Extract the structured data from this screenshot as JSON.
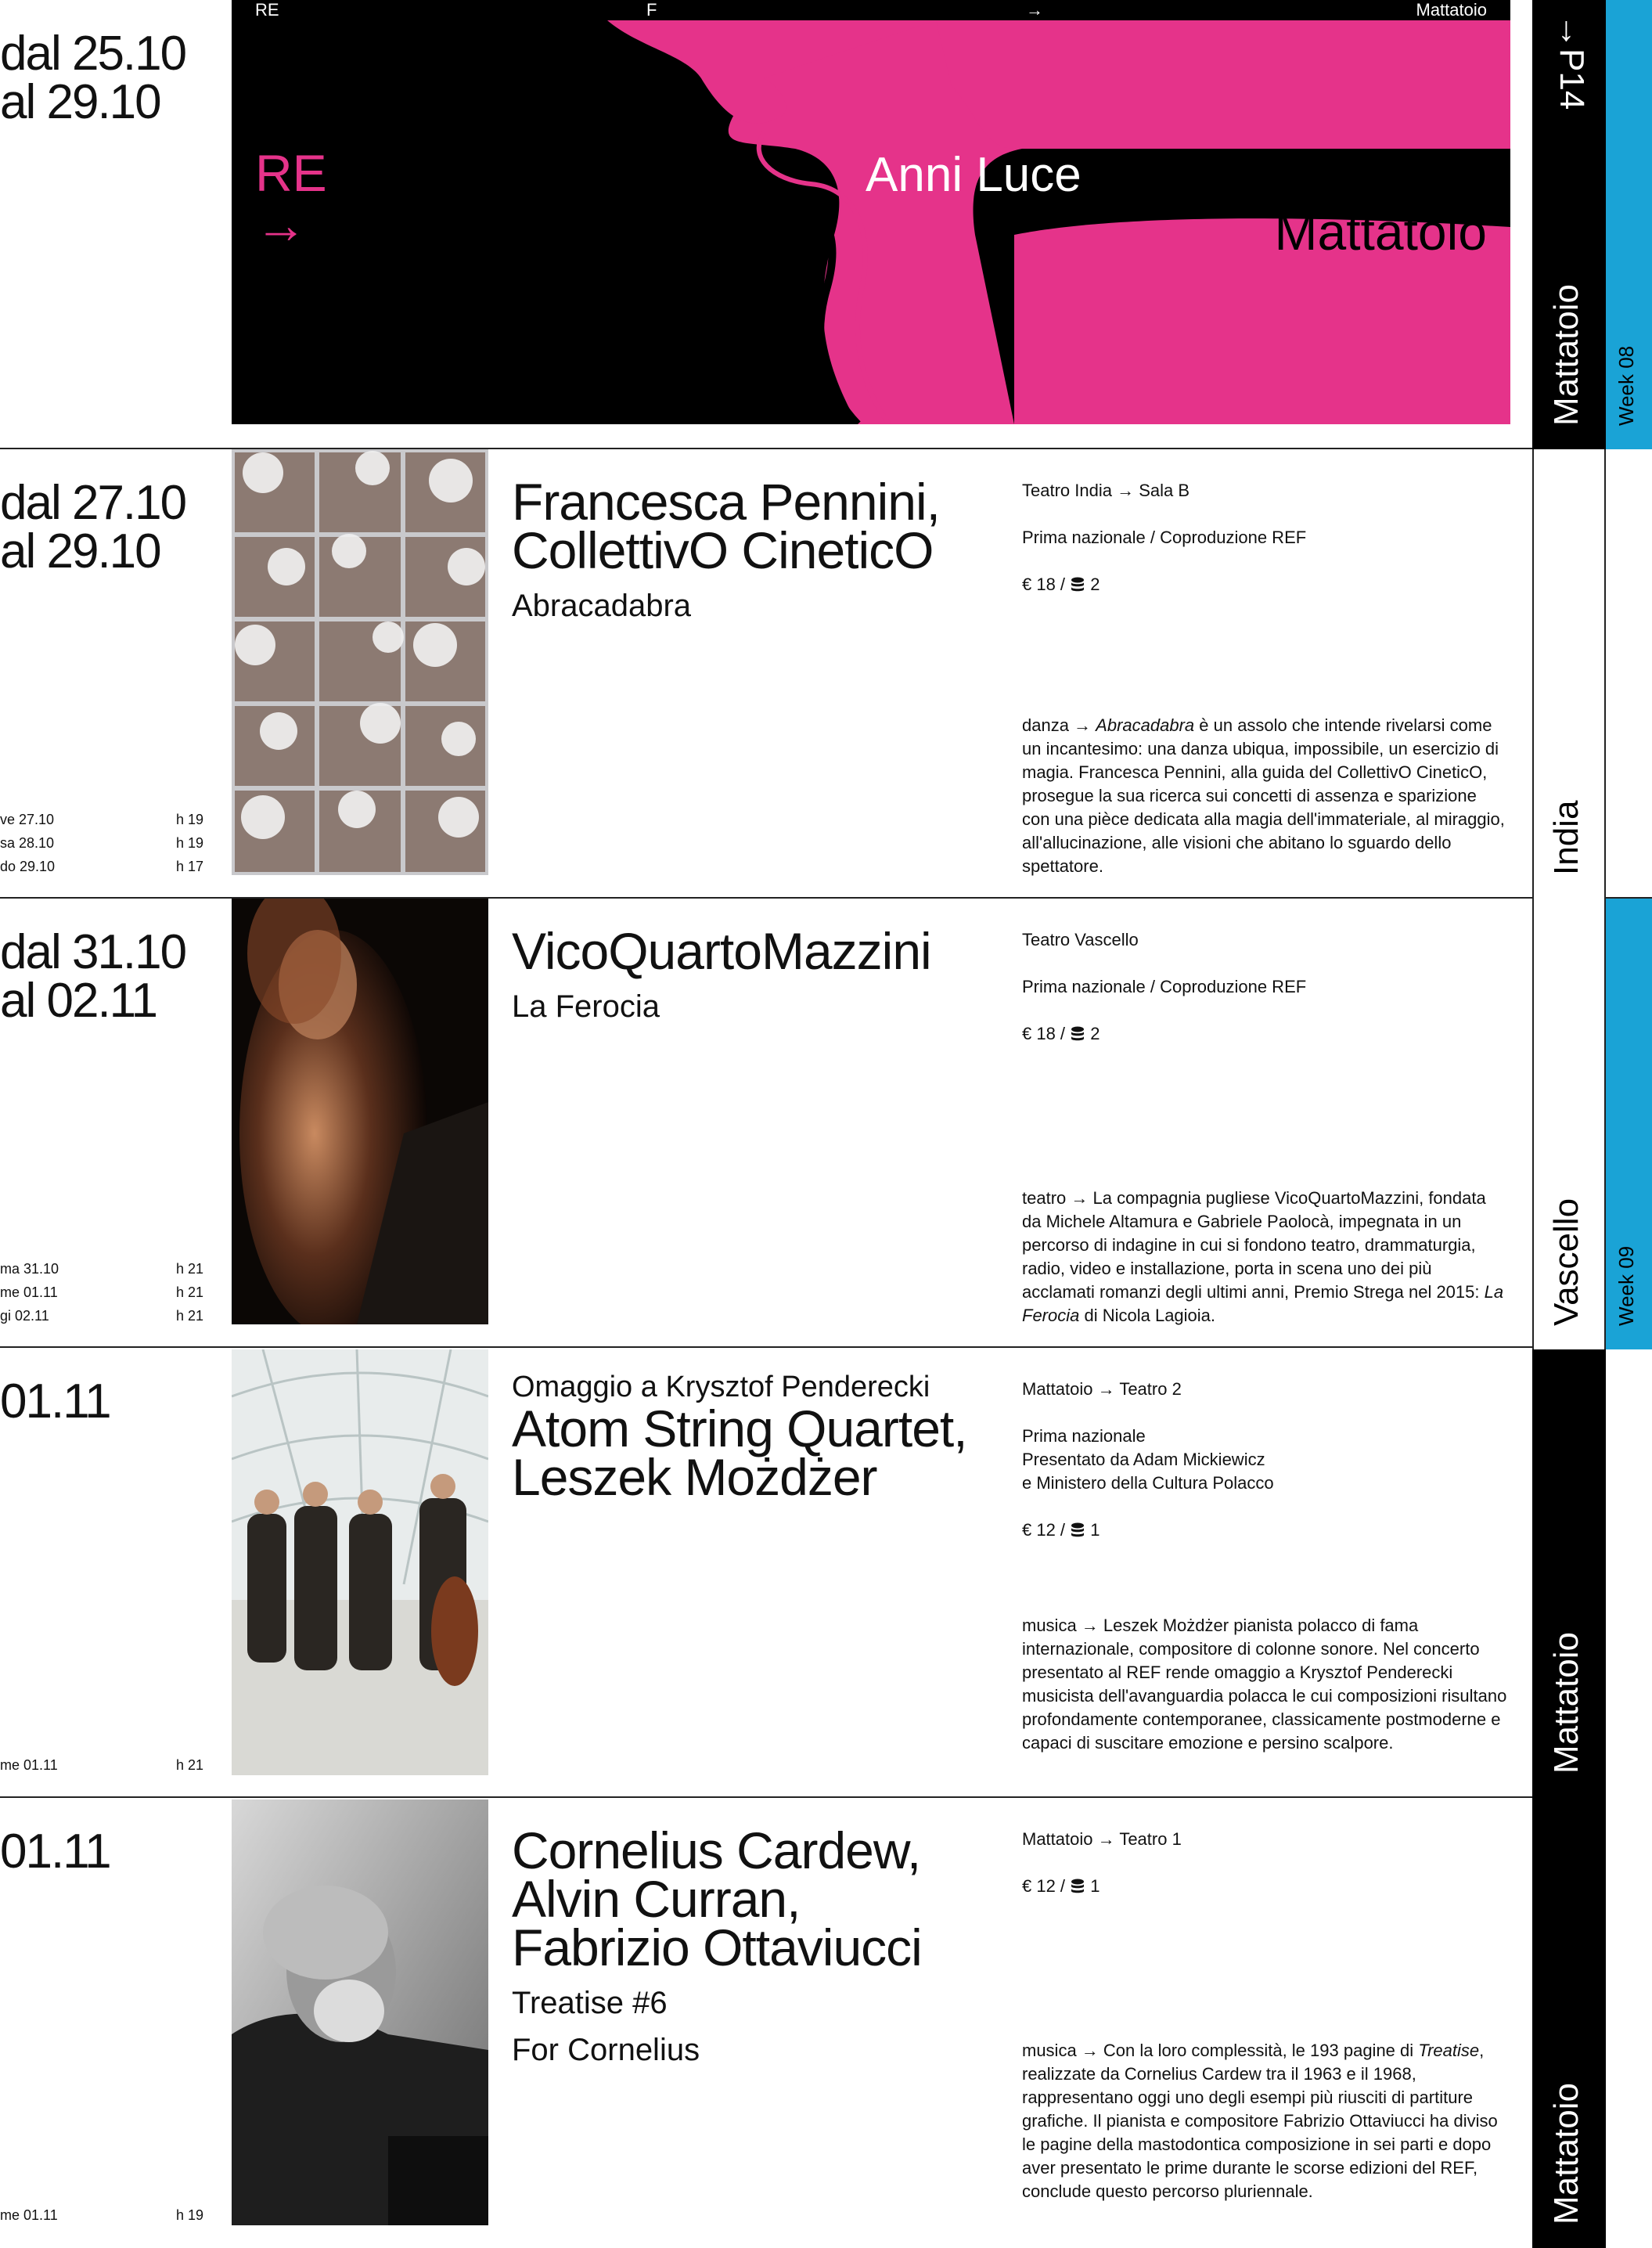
{
  "banner_row": {
    "date_line1": "dal 25.10",
    "date_line2": "al 29.10",
    "top_strip": [
      "RE",
      "F",
      "→",
      "Mattatoio"
    ],
    "left_mark": "RE",
    "left_arrow": "→",
    "center_text": "Anni Luce",
    "right_mark": "F",
    "right_venue": "Mattatoio",
    "venue_vertical": "Mattatoio",
    "page_ref": "→P14",
    "week": "Week 08"
  },
  "events": [
    {
      "date_line1": "dal 27.10",
      "date_line2": "al 29.10",
      "schedule": [
        {
          "day": "ve 27.10",
          "hour": "h 19"
        },
        {
          "day": "sa 28.10",
          "hour": "h 19"
        },
        {
          "day": "do 29.10",
          "hour": "h 17"
        }
      ],
      "artist_line1": "Francesca Pennini,",
      "artist_line2": "CollettivO CineticO",
      "work": "Abracadabra",
      "venue": "Teatro India → Sala B",
      "premiere": "Prima nazionale / Coproduzione REF",
      "price": "€ 18 /",
      "tokens": "2",
      "desc_genre": "danza → ",
      "desc_title": "Abracadabra",
      "desc_body": " è un assolo che intende rivelarsi come un incantesimo: una danza ubiqua, impossibile, un esercizio di magia. Francesca Pennini, alla guida del CollettivO CineticO, prosegue la sua ricerca sui concetti di assenza e sparizione con una pièce dedicata alla magia dell'immateriale, al miraggio, all'allucinazione, alle visioni che abitano lo sguardo dello spettatore.",
      "venue_vertical": "India"
    },
    {
      "date_line1": "dal 31.10",
      "date_line2": "al 02.11",
      "schedule": [
        {
          "day": "ma 31.10",
          "hour": "h 21"
        },
        {
          "day": "me 01.11",
          "hour": "h 21"
        },
        {
          "day": "gi 02.11",
          "hour": "h 21"
        }
      ],
      "artist_line1": "VicoQuartoMazzini",
      "work": "La Ferocia",
      "venue": "Teatro Vascello",
      "premiere": "Prima nazionale / Coproduzione REF",
      "price": "€ 18 /",
      "tokens": "2",
      "desc_body": "teatro → La compagnia pugliese VicoQuartoMazzini, fondata da Michele Altamura e Gabriele Paolocà, impegnata in un percorso di indagine in cui si fondono teatro, drammaturgia, radio, video e installazione, porta in scena uno dei più acclamati romanzi degli ultimi anni, Premio Strega nel 2015: ",
      "desc_title": "La Ferocia",
      "desc_tail": " di Nicola Lagioia.",
      "venue_vertical": "Vascello",
      "week": "Week 09"
    },
    {
      "date_line1": "01.11",
      "schedule": [
        {
          "day": "me 01.11",
          "hour": "h 21"
        }
      ],
      "pre_title": "Omaggio a Krysztof Penderecki",
      "artist_line1": "Atom String Quartet,",
      "artist_line2": "Leszek Możdżer",
      "venue": "Mattatoio → Teatro 2",
      "premiere_line1": "Prima nazionale",
      "premiere_line2": "Presentato da Adam Mickiewicz",
      "premiere_line3": "e Ministero della Cultura Polacco",
      "price": "€ 12 /",
      "tokens": "1",
      "desc_body": "musica → Leszek Możdżer pianista polacco di fama internazionale, compositore di colonne sonore. Nel concerto presentato al REF rende omaggio a Krysztof Penderecki musicista dell'avanguardia polacca le cui composizioni risultano profondamente contemporanee, classicamente postmoderne e capaci di suscitare emozione e persino scalpore.",
      "venue_vertical": "Mattatoio"
    },
    {
      "date_line1": "01.11",
      "schedule": [
        {
          "day": "me 01.11",
          "hour": "h 19"
        }
      ],
      "artist_line1": "Cornelius Cardew,",
      "artist_line2": "Alvin Curran,",
      "artist_line3": "Fabrizio Ottaviucci",
      "work": "Treatise #6",
      "work2": "For Cornelius",
      "venue": "Mattatoio → Teatro 1",
      "price": "€ 12 /",
      "tokens": "1",
      "desc_genre": "musica → Con la loro complessità, le 193 pagine di ",
      "desc_title": "Treatise",
      "desc_body": ", realizzate da Cornelius Cardew tra il 1963 e il 1968, rappresentano oggi uno degli esempi più riusciti di partiture grafiche. Il pianista e compositore Fabrizio Ottaviucci ha diviso le pagine della mastodontica composizione in sei parti e dopo aver presentato le prime durante le scorse edizioni del REF, conclude questo percorso pluriennale.",
      "venue_vertical": "Mattatoio"
    }
  ],
  "colors": {
    "magenta": "#e5338a",
    "blue": "#1aa3d6",
    "black": "#000000"
  }
}
